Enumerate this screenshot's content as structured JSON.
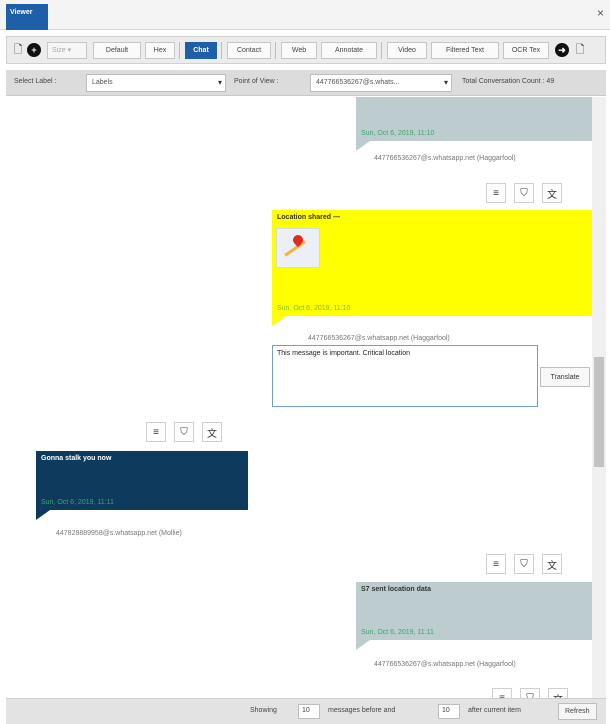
{
  "window": {
    "tab_label": "Viewer",
    "close_glyph": "×"
  },
  "toolbar": {
    "icons": [
      "document-icon",
      "add-circle-icon",
      "arrow-right-circle-icon",
      "document-icon"
    ],
    "size_select": "Size",
    "buttons": [
      "Default",
      "Hex",
      "Chat",
      "Contact",
      "Web",
      "Annotate",
      "Video",
      "Filtered Text",
      "OCR Tex"
    ],
    "active_button": "Chat"
  },
  "filter": {
    "select_label_label": "Select Label :",
    "labels_value": "Labels",
    "pov_label": "Point of View :",
    "pov_value": "447766536267@s.whats...",
    "count_label": "Total Conversation Count : 49"
  },
  "messages": {
    "m1": {
      "timestamp": "Sun, Oct 6, 2019, 11:10",
      "sender": "447766536267@s.whatsapp.net (Haggarfool)"
    },
    "m2": {
      "title": "Location shared",
      "title_suffix": "—",
      "timestamp": "Sun, Oct 6, 2019, 11:10",
      "sender": "447766536267@s.whatsapp.net (Haggarfool)"
    },
    "note": {
      "text": "This message is important. Critical location",
      "translate_label": "Translate"
    },
    "m3": {
      "title": "Gonna stalk you now",
      "timestamp": "Sun, Oct 6, 2019, 11:11",
      "sender": "447828889958@s.whatsapp.net (Mollie)"
    },
    "m4": {
      "title": "S7 sent location data",
      "timestamp": "Sun, Oct 6, 2019, 11:11",
      "sender": "447766536267@s.whatsapp.net (Haggarfool)"
    }
  },
  "action_icons": {
    "glyphs": [
      "≡",
      "⛉",
      "文"
    ],
    "names": [
      "annotate-icon",
      "tag-icon",
      "translate-icon"
    ]
  },
  "status": {
    "showing_label": "Showing",
    "before_value": "10",
    "before_label": "messages before and",
    "after_value": "10",
    "after_label": "after current item",
    "refresh_label": "Refresh"
  },
  "colors": {
    "accent": "#1f5ea8",
    "grey_bubble": "#bdcccf",
    "yellow_bubble": "#ffff00",
    "navy_bubble": "#0e3a5d",
    "timestamp": "#3aa76d"
  }
}
